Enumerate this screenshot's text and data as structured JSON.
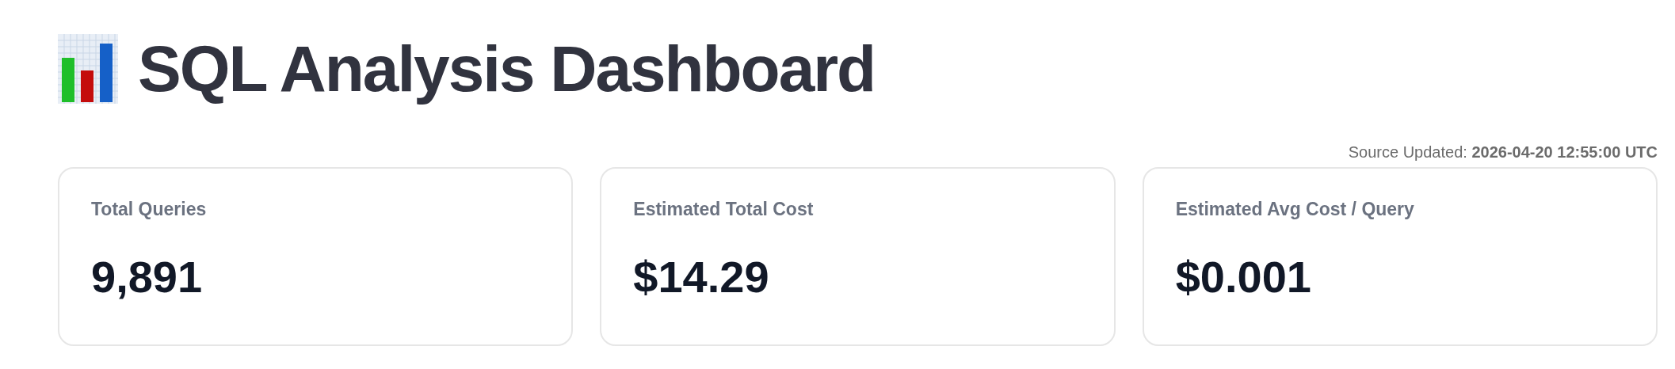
{
  "title": "SQL Analysis Dashboard",
  "source_updated": {
    "label": "Source Updated:",
    "value": "2026-04-20 12:55:00 UTC"
  },
  "metrics": [
    {
      "label": "Total Queries",
      "value": "9,891"
    },
    {
      "label": "Estimated Total Cost",
      "value": "$14.29"
    },
    {
      "label": "Estimated Avg Cost / Query",
      "value": "$0.001"
    }
  ]
}
